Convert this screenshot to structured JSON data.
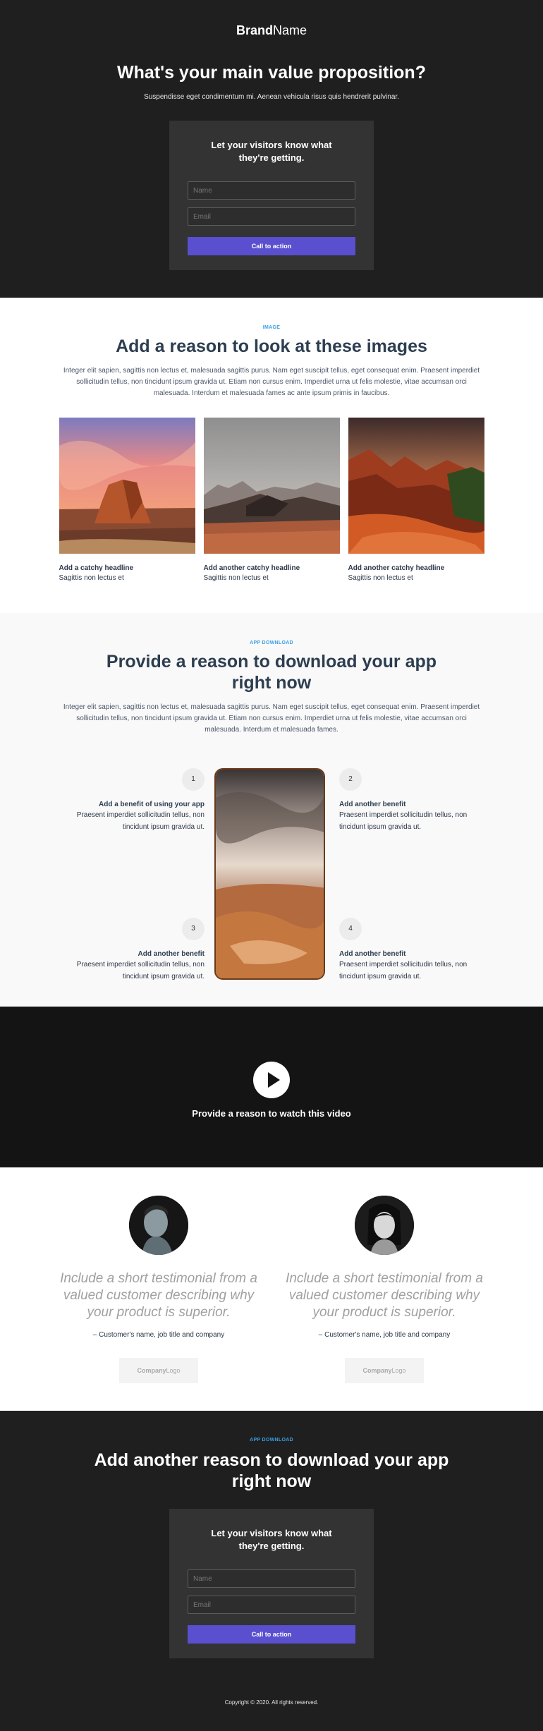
{
  "hero": {
    "brand_bold": "Brand",
    "brand_light": "Name",
    "title": "What's your main value proposition?",
    "subtitle": "Suspendisse eget condimentum mi. Aenean vehicula risus quis hendrerit pulvinar.",
    "form": {
      "title": "Let your visitors know what they're getting.",
      "name_placeholder": "Name",
      "email_placeholder": "Email",
      "cta_label": "Call to action"
    }
  },
  "images_section": {
    "eyebrow": "IMAGE",
    "title": "Add a reason to look at these images",
    "paragraph": "Integer elit sapien, sagittis non lectus et, malesuada sagittis purus. Nam eget suscipit tellus, eget consequat enim. Praesent imperdiet sollicitudin tellus, non tincidunt ipsum gravida ut. Etiam non cursus enim. Imperdiet urna ut felis molestie, vitae accumsan orci malesuada. Interdum et malesuada fames ac ante ipsum primis in faucibus.",
    "cards": [
      {
        "headline": "Add a catchy headline",
        "text": "Sagittis non lectus et"
      },
      {
        "headline": "Add another catchy headline",
        "text": "Sagittis non lectus et"
      },
      {
        "headline": "Add another catchy headline",
        "text": "Sagittis non lectus et"
      }
    ]
  },
  "app_section": {
    "eyebrow": "APP DOWNLOAD",
    "title_line1": "Provide a reason to download your app",
    "title_line2": "right now",
    "paragraph": "Integer elit sapien, sagittis non lectus et, malesuada sagittis purus. Nam eget suscipit tellus, eget consequat enim. Praesent imperdiet sollicitudin tellus, non tincidunt ipsum gravida ut. Etiam non cursus enim. Imperdiet urna ut felis molestie, vitae accumsan orci malesuada. Interdum et malesuada fames.",
    "benefits": [
      {
        "num": "1",
        "title": "Add a benefit of using your app",
        "text": "Praesent imperdiet sollicitudin tellus, non tincidunt ipsum gravida ut."
      },
      {
        "num": "2",
        "title": "Add another benefit",
        "text": "Praesent imperdiet sollicitudin tellus, non tincidunt ipsum gravida ut."
      },
      {
        "num": "3",
        "title": "Add another benefit",
        "text": "Praesent imperdiet sollicitudin tellus, non tincidunt ipsum gravida ut."
      },
      {
        "num": "4",
        "title": "Add another benefit",
        "text": "Praesent imperdiet sollicitudin tellus, non tincidunt ipsum gravida ut."
      }
    ]
  },
  "video_section": {
    "caption": "Provide a reason to watch this video",
    "icon": "play-icon"
  },
  "testimonials": [
    {
      "quote": "Include a short testimonial from a valued customer describing why your product is superior.",
      "author": "– Customer's name, job title and company",
      "logo_bold": "Company",
      "logo_light": "Logo"
    },
    {
      "quote": "Include a short testimonial from a valued customer describing why your product is superior.",
      "author": "– Customer's name, job title and company",
      "logo_bold": "Company",
      "logo_light": "Logo"
    }
  ],
  "bottom_section": {
    "eyebrow": "APP DOWNLOAD",
    "title_line1": "Add another reason to download your app",
    "title_line2": "right now",
    "form": {
      "title": "Let your visitors know what they're getting.",
      "name_placeholder": "Name",
      "email_placeholder": "Email",
      "cta_label": "Call to action"
    },
    "footer": "Copyright © 2020. All rights reserved."
  },
  "colors": {
    "dark_bg": "#1f1f1f",
    "card_bg": "#333333",
    "accent": "#5a4fcf",
    "eyebrow": "#3ba0e6",
    "heading": "#2d3e50"
  }
}
